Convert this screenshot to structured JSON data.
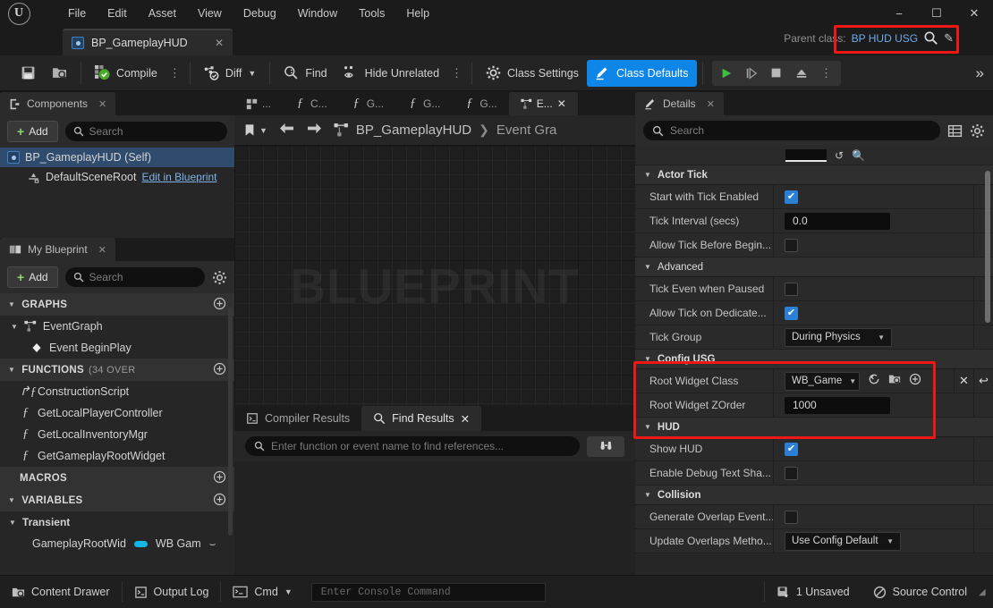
{
  "app": {
    "logo": "unreal-logo",
    "menu": [
      "File",
      "Edit",
      "Asset",
      "View",
      "Debug",
      "Window",
      "Tools",
      "Help"
    ],
    "window_controls": {
      "minimize": "−",
      "maximize": "☐",
      "close": "✕"
    }
  },
  "asset_tab": {
    "title": "BP_GameplayHUD",
    "close": "✕",
    "icon": "blueprint-icon"
  },
  "parent_class": {
    "label": "Parent class:",
    "value": "BP HUD USG",
    "search_icon": "search-icon",
    "edit_icon": "pencil-icon",
    "highlight_color": "#f01717"
  },
  "toolbar": {
    "save": "save-icon",
    "browse": "browse-icon",
    "compile_label": "Compile",
    "diff_label": "Diff",
    "find_label": "Find",
    "hide_unrelated_label": "Hide Unrelated",
    "class_settings_label": "Class Settings",
    "class_defaults_label": "Class Defaults",
    "class_defaults_active": true,
    "accent_color": "#0e86e8",
    "play_controls": [
      "play-icon",
      "step-icon",
      "stop-icon",
      "eject-icon",
      "more-icon"
    ],
    "overflow": "»"
  },
  "components_panel": {
    "tab_title": "Components",
    "tab_close": "✕",
    "add_label": "Add",
    "search_placeholder": "Search",
    "items": [
      {
        "label": "BP_GameplayHUD (Self)",
        "selected": true,
        "icon": "blueprint-icon"
      },
      {
        "label": "DefaultSceneRoot",
        "link": "Edit in Blueprint",
        "selected": false,
        "icon": "scene-root-icon"
      }
    ]
  },
  "my_blueprint_panel": {
    "tab_title": "My Blueprint",
    "tab_close": "✕",
    "add_label": "Add",
    "search_placeholder": "Search",
    "settings_icon": "gear-icon",
    "sections": [
      {
        "title": "GRAPHS",
        "count": "",
        "items": [
          {
            "label": "EventGraph",
            "level": 1,
            "icon": "graph-icon"
          },
          {
            "label": "Event BeginPlay",
            "level": 2,
            "icon": "event-node-icon"
          }
        ]
      },
      {
        "title": "FUNCTIONS",
        "count": "(34 OVER",
        "items": [
          {
            "label": "ConstructionScript",
            "level": 3,
            "icon": "function-icon"
          },
          {
            "label": "GetLocalPlayerController",
            "level": 3,
            "icon": "function-icon"
          },
          {
            "label": "GetLocalInventoryMgr",
            "level": 3,
            "icon": "function-icon"
          },
          {
            "label": "GetGameplayRootWidget",
            "level": 3,
            "icon": "function-icon"
          }
        ]
      },
      {
        "title": "MACROS",
        "count": "",
        "items": []
      },
      {
        "title": "VARIABLES",
        "count": "",
        "items": [
          {
            "label": "Transient",
            "level": 1,
            "icon": "category-icon"
          },
          {
            "label": "GameplayRootWid",
            "level": 2,
            "type": "WB Gam",
            "icon": "variable-pill"
          }
        ]
      }
    ]
  },
  "graph_panel": {
    "doc_tabs": [
      {
        "label": "...",
        "icon": "viewport-icon",
        "active": false
      },
      {
        "label": "C...",
        "icon": "function-icon",
        "active": false
      },
      {
        "label": "G...",
        "icon": "function-icon",
        "active": false
      },
      {
        "label": "G...",
        "icon": "function-icon",
        "active": false
      },
      {
        "label": "G...",
        "icon": "function-icon",
        "active": false
      },
      {
        "label": "E...",
        "icon": "graph-icon",
        "active": true,
        "close": "✕"
      }
    ],
    "bookmark_icon": "bookmark-icon",
    "back_icon": "arrow-left-icon",
    "forward_icon": "arrow-right-icon",
    "breadcrumb_icon": "graph-icon",
    "breadcrumb": [
      "BP_GameplayHUD",
      "Event Gra"
    ],
    "breadcrumb_sep": "❯",
    "watermark": "BLUEPRINT"
  },
  "results_panel": {
    "tabs": [
      {
        "label": "Compiler Results",
        "icon": "compiler-icon",
        "active": false
      },
      {
        "label": "Find Results",
        "icon": "search-icon",
        "active": true,
        "close": "✕"
      }
    ],
    "search_placeholder": "Enter function or event name to find references...",
    "find_button_icon": "binoculars-icon"
  },
  "details_panel": {
    "tab_title": "Details",
    "tab_close": "✕",
    "search_placeholder": "Search",
    "grid_icon": "grid-view-icon",
    "settings_icon": "gear-icon",
    "categories": [
      {
        "title": "Actor Tick",
        "highlighted": false,
        "rows": [
          {
            "name": "Start with Tick Enabled",
            "kind": "checkbox",
            "checked": true
          },
          {
            "name": "Tick Interval (secs)",
            "kind": "text",
            "value": "0.0"
          },
          {
            "name": "Allow Tick Before Begin...",
            "kind": "checkbox",
            "checked": false
          }
        ]
      },
      {
        "title": "Advanced",
        "highlighted": false,
        "rows": [
          {
            "name": "Tick Even when Paused",
            "kind": "checkbox",
            "checked": false
          },
          {
            "name": "Allow Tick on Dedicate...",
            "kind": "checkbox",
            "checked": true
          },
          {
            "name": "Tick Group",
            "kind": "dropdown",
            "value": "During Physics"
          }
        ]
      },
      {
        "title": "Config USG",
        "highlighted": true,
        "rows": [
          {
            "name": "Root Widget Class",
            "kind": "asset",
            "value": "WB_Game",
            "icons": [
              "use-selected-icon",
              "browse-icon",
              "new-asset-icon",
              "clear-icon",
              "reset-icon"
            ]
          },
          {
            "name": "Root Widget ZOrder",
            "kind": "text",
            "value": "1000"
          }
        ]
      },
      {
        "title": "HUD",
        "highlighted": false,
        "rows": [
          {
            "name": "Show HUD",
            "kind": "checkbox",
            "checked": true
          },
          {
            "name": "Enable Debug Text Sha...",
            "kind": "checkbox",
            "checked": false
          }
        ]
      },
      {
        "title": "Collision",
        "highlighted": false,
        "rows": [
          {
            "name": "Generate Overlap Event...",
            "kind": "checkbox",
            "checked": false
          },
          {
            "name": "Update Overlaps Metho...",
            "kind": "dropdown",
            "value": "Use Config Default"
          }
        ]
      }
    ]
  },
  "status_bar": {
    "content_drawer": "Content Drawer",
    "output_log": "Output Log",
    "cmd_label": "Cmd",
    "console_placeholder": "Enter Console Command",
    "unsaved": "1 Unsaved",
    "source_control": "Source Control"
  }
}
